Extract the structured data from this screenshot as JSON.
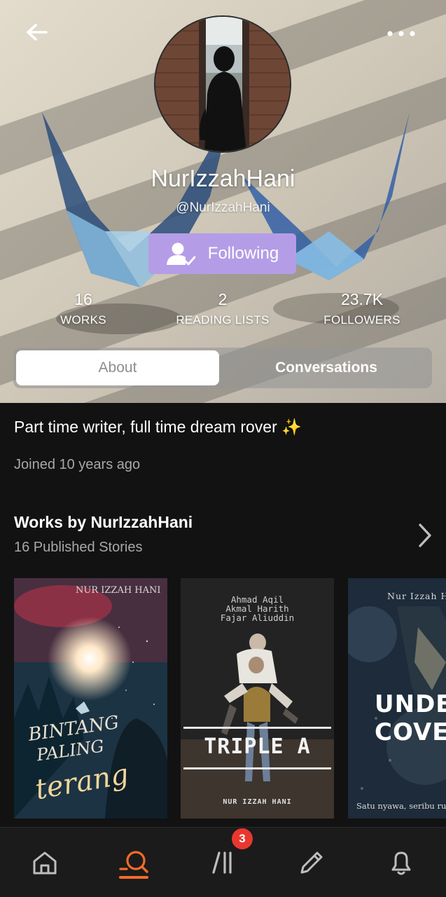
{
  "profile": {
    "display_name": "NurIzzahHani",
    "handle": "@NurIzzahHani",
    "follow_label": "Following",
    "stats": [
      {
        "value": "16",
        "label": "WORKS"
      },
      {
        "value": "2",
        "label": "READING LISTS"
      },
      {
        "value": "23.7K",
        "label": "FOLLOWERS"
      }
    ]
  },
  "tabs": [
    {
      "label": "About",
      "selected": true
    },
    {
      "label": "Conversations",
      "selected": false
    }
  ],
  "about": {
    "bio": "Part time writer, full time dream rover ✨",
    "joined": "Joined 10 years ago"
  },
  "works": {
    "title": "Works by NurIzzahHani",
    "subtitle": "16 Published Stories",
    "covers": [
      {
        "author": "NUR IZZAH HANI",
        "title_line1": "BINTANG",
        "title_line2": "PALING",
        "title_line3": "terang"
      },
      {
        "names": [
          "Ahmad Aqil",
          "Akmal Harith",
          "Fajar Aliuddin"
        ],
        "title": "TRIPLE A",
        "author": "NUR IZZAH HANI"
      },
      {
        "author": "Nur Izzah H",
        "title_line1": "UNDE",
        "title_line2": "COVE",
        "tagline": "Satu nyawa, seribu rupa"
      }
    ]
  },
  "nav": {
    "items": [
      "home-icon",
      "discover-icon",
      "library-icon",
      "write-icon",
      "notifications-icon"
    ],
    "active": "discover-icon",
    "library_badge": "3"
  },
  "colors": {
    "accent": "#f36b2a",
    "follow_button": "#b49de6",
    "badge": "#e8372f",
    "background": "#121212"
  }
}
